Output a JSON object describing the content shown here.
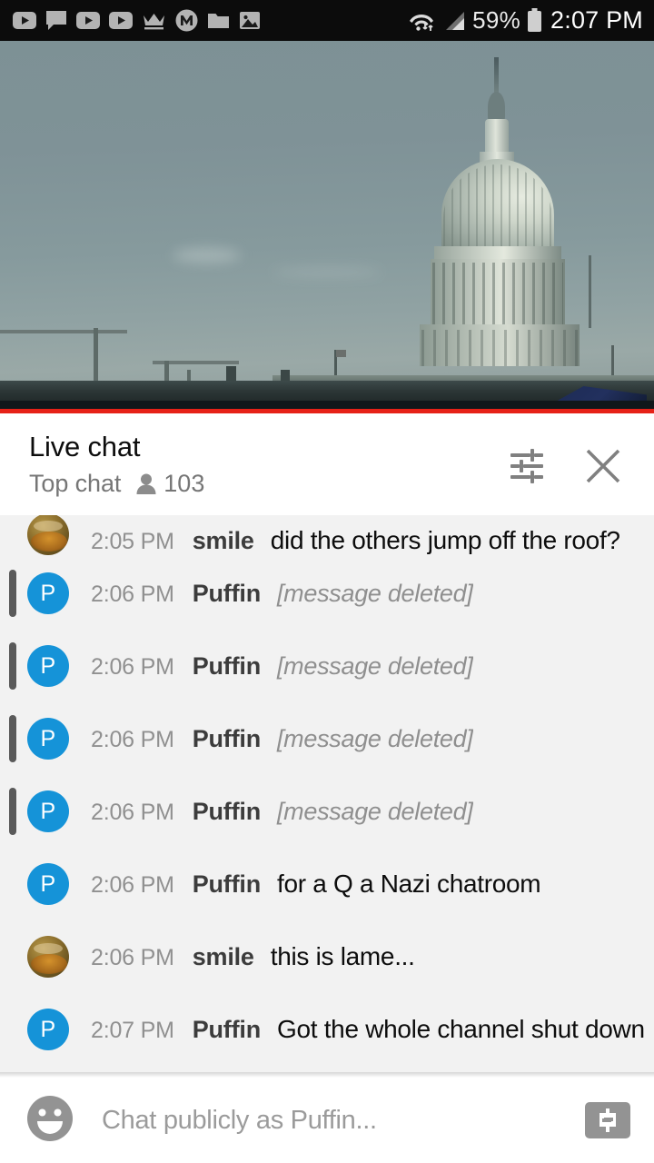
{
  "status_bar": {
    "icons": [
      "youtube-play-icon",
      "chat-bubble-icon",
      "youtube-play-icon",
      "youtube-play-icon",
      "crown-icon",
      "m-circle-icon",
      "folder-icon",
      "image-icon"
    ],
    "wifi_icon": "wifi-data-icon",
    "signal_icon": "cell-signal-icon",
    "battery_percent": "59%",
    "battery_icon": "battery-icon",
    "clock": "2:07 PM"
  },
  "video": {
    "name": "us-capitol-live-stream",
    "progress_color": "#e62117",
    "is_live": true
  },
  "chat_header": {
    "title": "Live chat",
    "mode": "Top chat",
    "viewer_icon": "person-icon",
    "viewer_count": "103",
    "settings_icon": "tune-icon",
    "close_icon": "close-icon"
  },
  "messages": [
    {
      "time": "2:05 PM",
      "author": "smile",
      "text": "did the others jump off the roof?",
      "avatar_type": "smile",
      "avatar_letter": "",
      "deleted": false,
      "partial": true
    },
    {
      "time": "2:06 PM",
      "author": "Puffin",
      "text": "[message deleted]",
      "avatar_type": "puffin",
      "avatar_letter": "P",
      "deleted": true,
      "partial": false
    },
    {
      "time": "2:06 PM",
      "author": "Puffin",
      "text": "[message deleted]",
      "avatar_type": "puffin",
      "avatar_letter": "P",
      "deleted": true,
      "partial": false
    },
    {
      "time": "2:06 PM",
      "author": "Puffin",
      "text": "[message deleted]",
      "avatar_type": "puffin",
      "avatar_letter": "P",
      "deleted": true,
      "partial": false
    },
    {
      "time": "2:06 PM",
      "author": "Puffin",
      "text": "[message deleted]",
      "avatar_type": "puffin",
      "avatar_letter": "P",
      "deleted": true,
      "partial": false
    },
    {
      "time": "2:06 PM",
      "author": "Puffin",
      "text": "for a Q a Nazi chatroom",
      "avatar_type": "puffin",
      "avatar_letter": "P",
      "deleted": false,
      "partial": false
    },
    {
      "time": "2:06 PM",
      "author": "smile",
      "text": "this is lame...",
      "avatar_type": "smile",
      "avatar_letter": "",
      "deleted": false,
      "partial": false
    },
    {
      "time": "2:07 PM",
      "author": "Puffin",
      "text": "Got the whole channel shut down",
      "avatar_type": "puffin",
      "avatar_letter": "P",
      "deleted": false,
      "partial": false
    }
  ],
  "input_bar": {
    "emoji_icon": "emoji-smiley-icon",
    "placeholder": "Chat publicly as Puffin...",
    "superchat_icon": "dollar-sign-icon"
  },
  "colors": {
    "accent_red": "#e62117",
    "avatar_blue": "#1593d8",
    "chat_background": "#f2f2f2",
    "muted_text": "#767676",
    "deleted_bar": "#5a5a5a"
  }
}
